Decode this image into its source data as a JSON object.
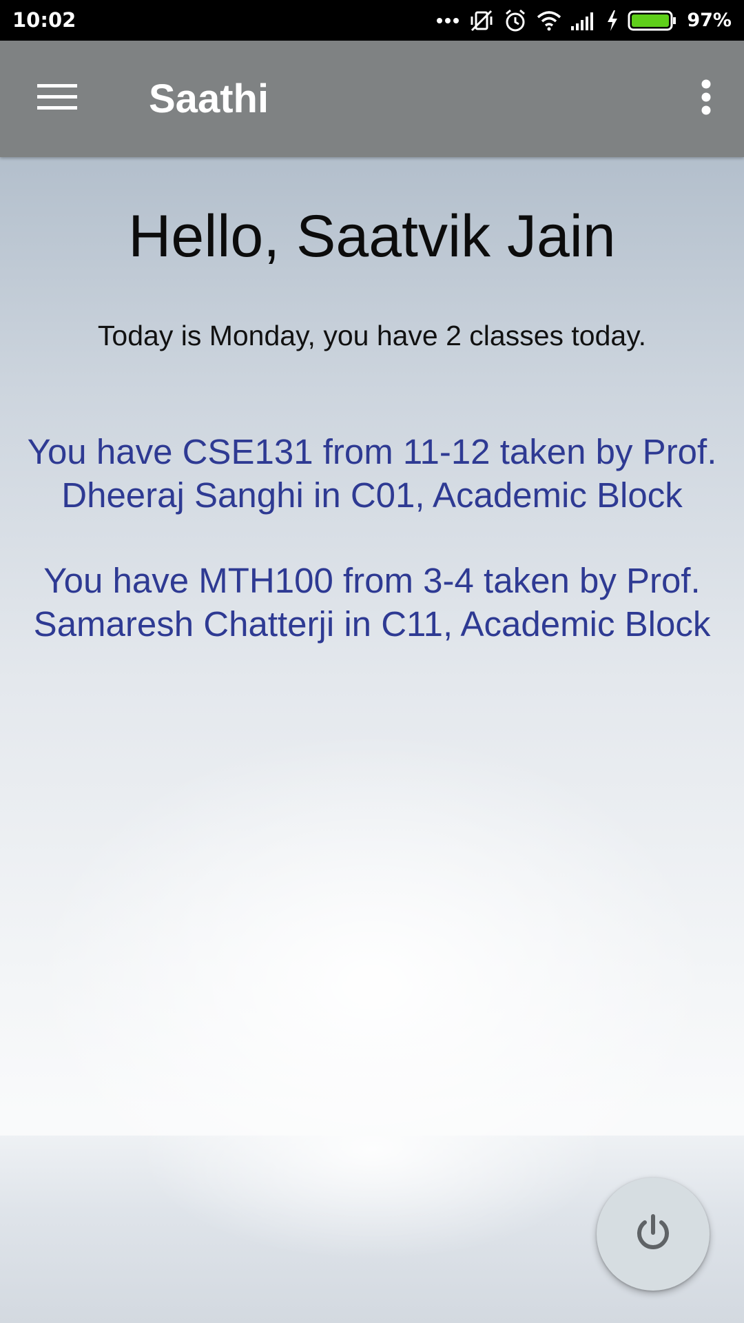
{
  "status_bar": {
    "time": "10:02",
    "battery_percent": "97%",
    "icons": [
      "more-notifications-icon",
      "vibrate-off-icon",
      "alarm-icon",
      "wifi-icon",
      "cellular-signal-icon",
      "charging-icon",
      "battery-icon"
    ],
    "battery_color": "#5fcf1a"
  },
  "app_bar": {
    "title": "Saathi",
    "background_color": "#7f8283",
    "menu_icon": "hamburger-menu-icon",
    "overflow_icon": "more-vert-icon"
  },
  "main": {
    "greeting": "Hello, Saatvik Jain",
    "today_summary": "Today is Monday, you have 2 classes today.",
    "class_text_color": "#2e3a93",
    "classes": [
      {
        "text": "You have CSE131 from 11-12 taken by Prof. Dheeraj Sanghi in C01, Academic Block"
      },
      {
        "text": "You have MTH100 from 3-4 taken by Prof. Samaresh Chatterji in C11, Academic Block"
      }
    ]
  },
  "fab": {
    "icon": "power-icon"
  }
}
